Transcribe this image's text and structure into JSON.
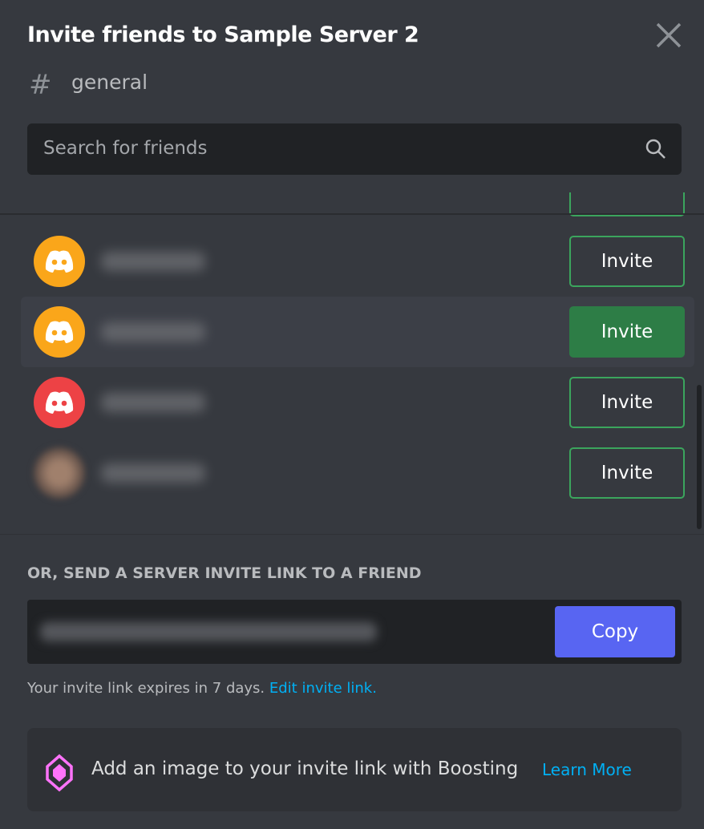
{
  "header": {
    "title": "Invite friends to Sample Server 2",
    "channel_icon": "#",
    "channel": "general"
  },
  "search": {
    "placeholder": "Search for friends"
  },
  "friends": [
    {
      "avatar_color": "#faa61a",
      "invite_label": "Invite",
      "hovered": false
    },
    {
      "avatar_color": "#faa61a",
      "invite_label": "Invite",
      "hovered": true
    },
    {
      "avatar_color": "#ed4245",
      "invite_label": "Invite",
      "hovered": false
    },
    {
      "avatar_color": "photo",
      "invite_label": "Invite",
      "hovered": false
    }
  ],
  "link_section": {
    "header": "OR, SEND A SERVER INVITE LINK TO A FRIEND",
    "copy_label": "Copy",
    "expiry_text": "Your invite link expires in 7 days. ",
    "edit_link": "Edit invite link."
  },
  "boost": {
    "text": "Add an image to your invite link with Boosting",
    "learn_more": "Learn More"
  },
  "colors": {
    "background": "#36393f",
    "input": "#202225",
    "green": "#3ba55d",
    "green_filled": "#2d7d46",
    "blurple": "#5865f2",
    "link": "#00b0f4",
    "boost_pink": "#ff73fa"
  }
}
